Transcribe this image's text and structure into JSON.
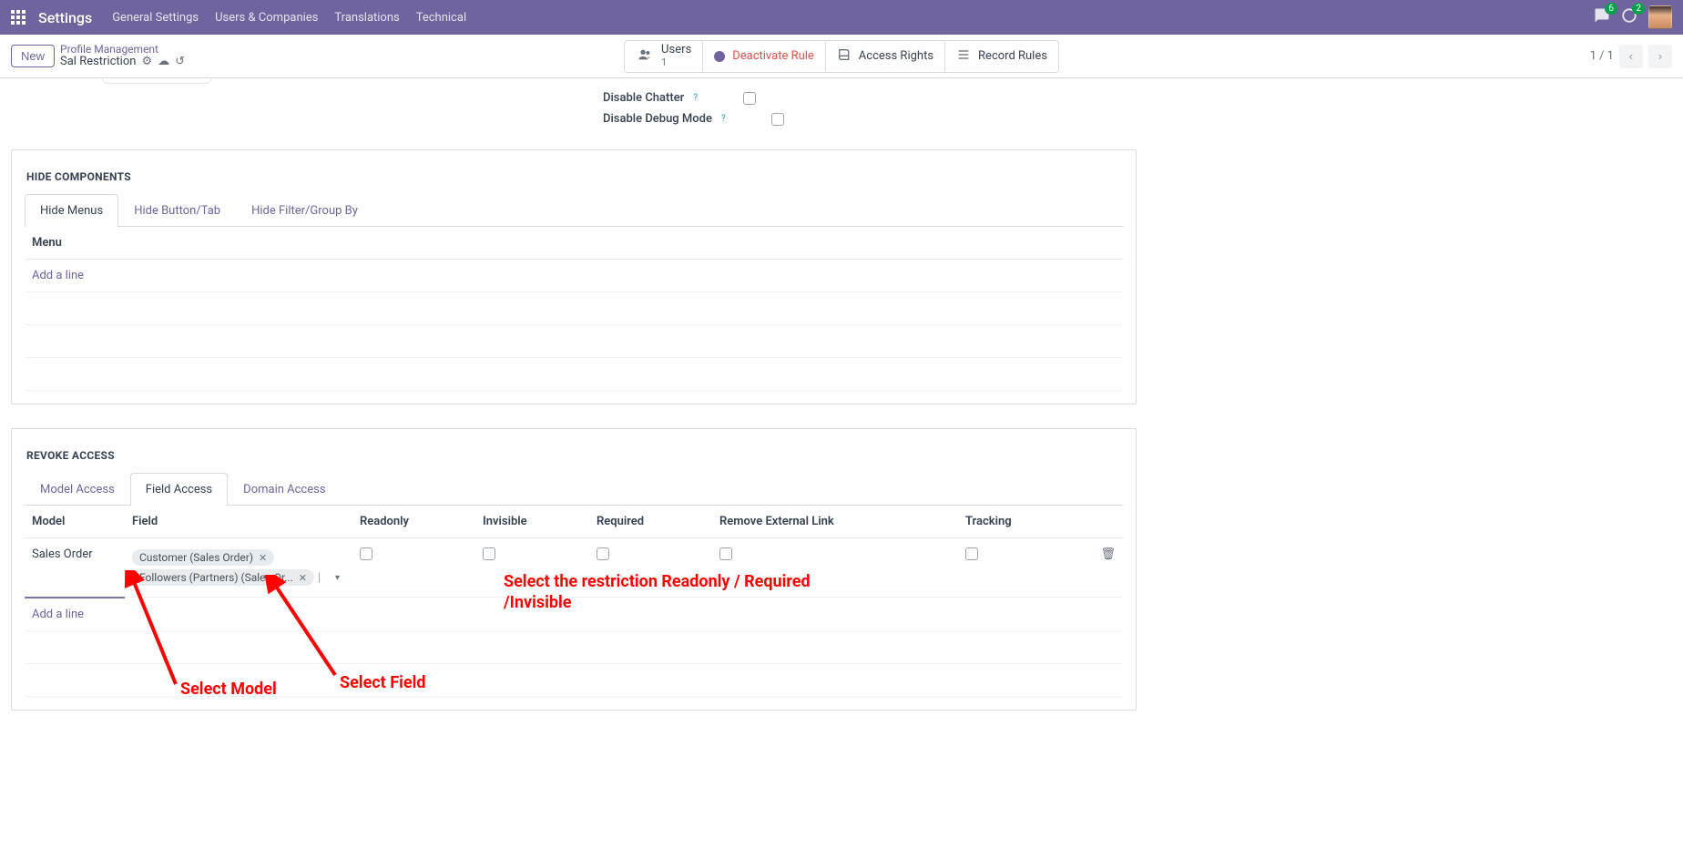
{
  "nav": {
    "app_title": "Settings",
    "links": [
      "General Settings",
      "Users & Companies",
      "Translations",
      "Technical"
    ],
    "chat_badge": "6",
    "activity_badge": "2"
  },
  "controlbar": {
    "new_label": "New",
    "breadcrumb_top": "Profile Management",
    "breadcrumb_record": "Sal Restriction",
    "stat_users_label": "Users",
    "stat_users_count": "1",
    "stat_deactivate": "Deactivate Rule",
    "stat_access_rights": "Access Rights",
    "stat_record_rules": "Record Rules",
    "pager": "1 / 1"
  },
  "fields": {
    "disable_chatter": "Disable Chatter",
    "disable_debug": "Disable Debug Mode"
  },
  "hide_components": {
    "title": "HIDE COMPONENTS",
    "tabs": [
      "Hide Menus",
      "Hide Button/Tab",
      "Hide Filter/Group By"
    ],
    "col_menu": "Menu",
    "add_line": "Add a line"
  },
  "revoke_access": {
    "title": "REVOKE ACCESS",
    "tabs": [
      "Model Access",
      "Field Access",
      "Domain Access"
    ],
    "columns": {
      "model": "Model",
      "field": "Field",
      "readonly": "Readonly",
      "invisible": "Invisible",
      "required": "Required",
      "remove_link": "Remove External Link",
      "tracking": "Tracking"
    },
    "row": {
      "model": "Sales Order",
      "tags": [
        "Customer (Sales Order)",
        "Followers (Partners) (Sales Or..."
      ]
    },
    "add_line": "Add a line"
  },
  "annotations": {
    "restriction_note": "Select the restriction Readonly / Required /Invisible",
    "select_model": "Select Model",
    "select_field": "Select Field"
  }
}
